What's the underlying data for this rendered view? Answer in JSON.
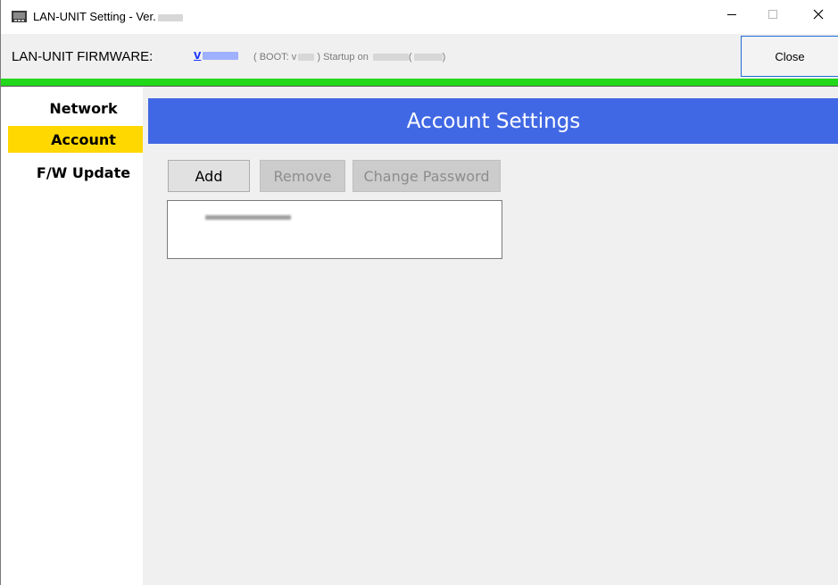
{
  "window": {
    "title": "LAN-UNIT Setting - Ver.",
    "minimize_glyph": "−",
    "maximize_glyph": "☐",
    "close_glyph": "✕"
  },
  "header": {
    "firmware_label": "LAN-UNIT FIRMWARE:",
    "firmware_version": "v",
    "boot_prefix": "( BOOT: v",
    "boot_middle": ") Startup on",
    "boot_paren_open": "(",
    "boot_paren_close": ")",
    "close_button": "Close"
  },
  "colors": {
    "accent_green": "#22d81a",
    "section_blue": "#4168e4",
    "active_yellow": "#ffd800",
    "link_blue": "#1a33ff"
  },
  "sidebar": {
    "items": [
      {
        "label": "Network",
        "active": false
      },
      {
        "label": "Account",
        "active": true
      },
      {
        "label": "F/W Update",
        "active": false
      }
    ]
  },
  "main": {
    "section_title": "Account Settings",
    "buttons": {
      "add": "Add",
      "remove": "Remove",
      "change_password": "Change Password"
    },
    "account_list": {
      "items": [
        "(redacted account name)"
      ]
    }
  }
}
